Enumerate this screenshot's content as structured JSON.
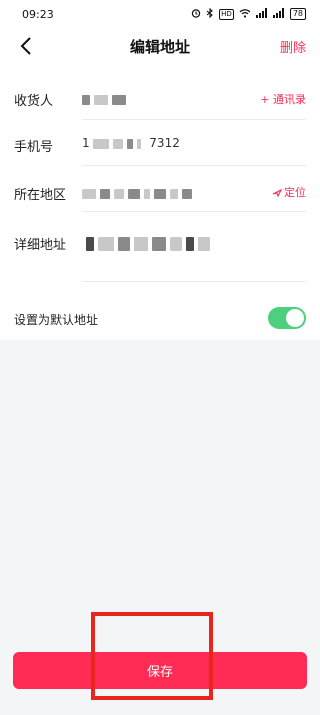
{
  "status_bar": {
    "time": "09:23",
    "icons": [
      "alarm-icon",
      "bluetooth-icon",
      "hd-icon",
      "wifi-icon",
      "signal-icon",
      "signal-icon",
      "battery-icon"
    ],
    "hd_label": "HD",
    "battery_level": "78"
  },
  "nav": {
    "back_icon": "chevron-left-icon",
    "title": "编辑地址",
    "delete_label": "删除"
  },
  "form": {
    "recipient": {
      "label": "收货人",
      "contacts_link": "+ 通讯录"
    },
    "phone": {
      "label": "手机号",
      "value_start": "1",
      "value_end": "7312"
    },
    "region": {
      "label": "所在地区",
      "locate_label": "定位",
      "locate_icon": "location-pin-icon"
    },
    "detail": {
      "label": "详细地址"
    }
  },
  "default_address": {
    "label": "设置为默认地址",
    "enabled": true,
    "accent_color": "#4cd07d"
  },
  "save_button": {
    "label": "保存",
    "color": "#fe2c55"
  },
  "highlight_color": "#e8261e"
}
